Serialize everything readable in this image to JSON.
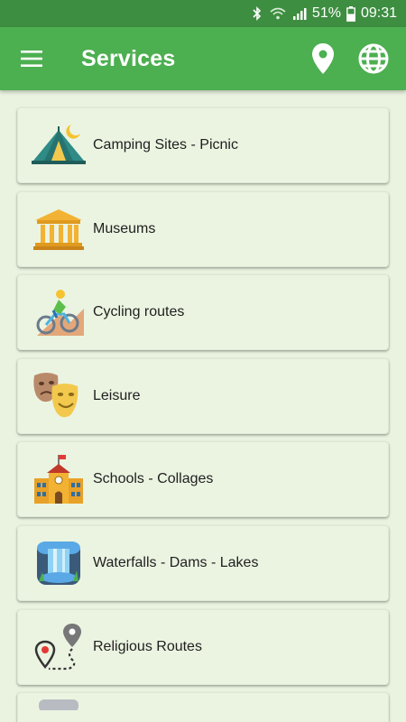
{
  "status_bar": {
    "battery": "51%",
    "time": "09:31"
  },
  "app_bar": {
    "title": "Services",
    "icons": [
      "menu-icon",
      "location-pin-icon",
      "globe-icon"
    ]
  },
  "services": [
    {
      "label": "Camping Sites - Picnic",
      "icon": "tent-icon"
    },
    {
      "label": "Museums",
      "icon": "museum-icon"
    },
    {
      "label": "Cycling routes",
      "icon": "cyclist-icon"
    },
    {
      "label": "Leisure",
      "icon": "theater-masks-icon"
    },
    {
      "label": "Schools - Collages",
      "icon": "school-icon"
    },
    {
      "label": "Waterfalls - Dams - Lakes",
      "icon": "waterfall-icon"
    },
    {
      "label": "Religious Routes",
      "icon": "route-icon"
    }
  ],
  "colors": {
    "status_bar": "#3e8e41",
    "app_bar": "#4caf50",
    "background": "#e9f3df",
    "card": "#ebf4e1"
  }
}
